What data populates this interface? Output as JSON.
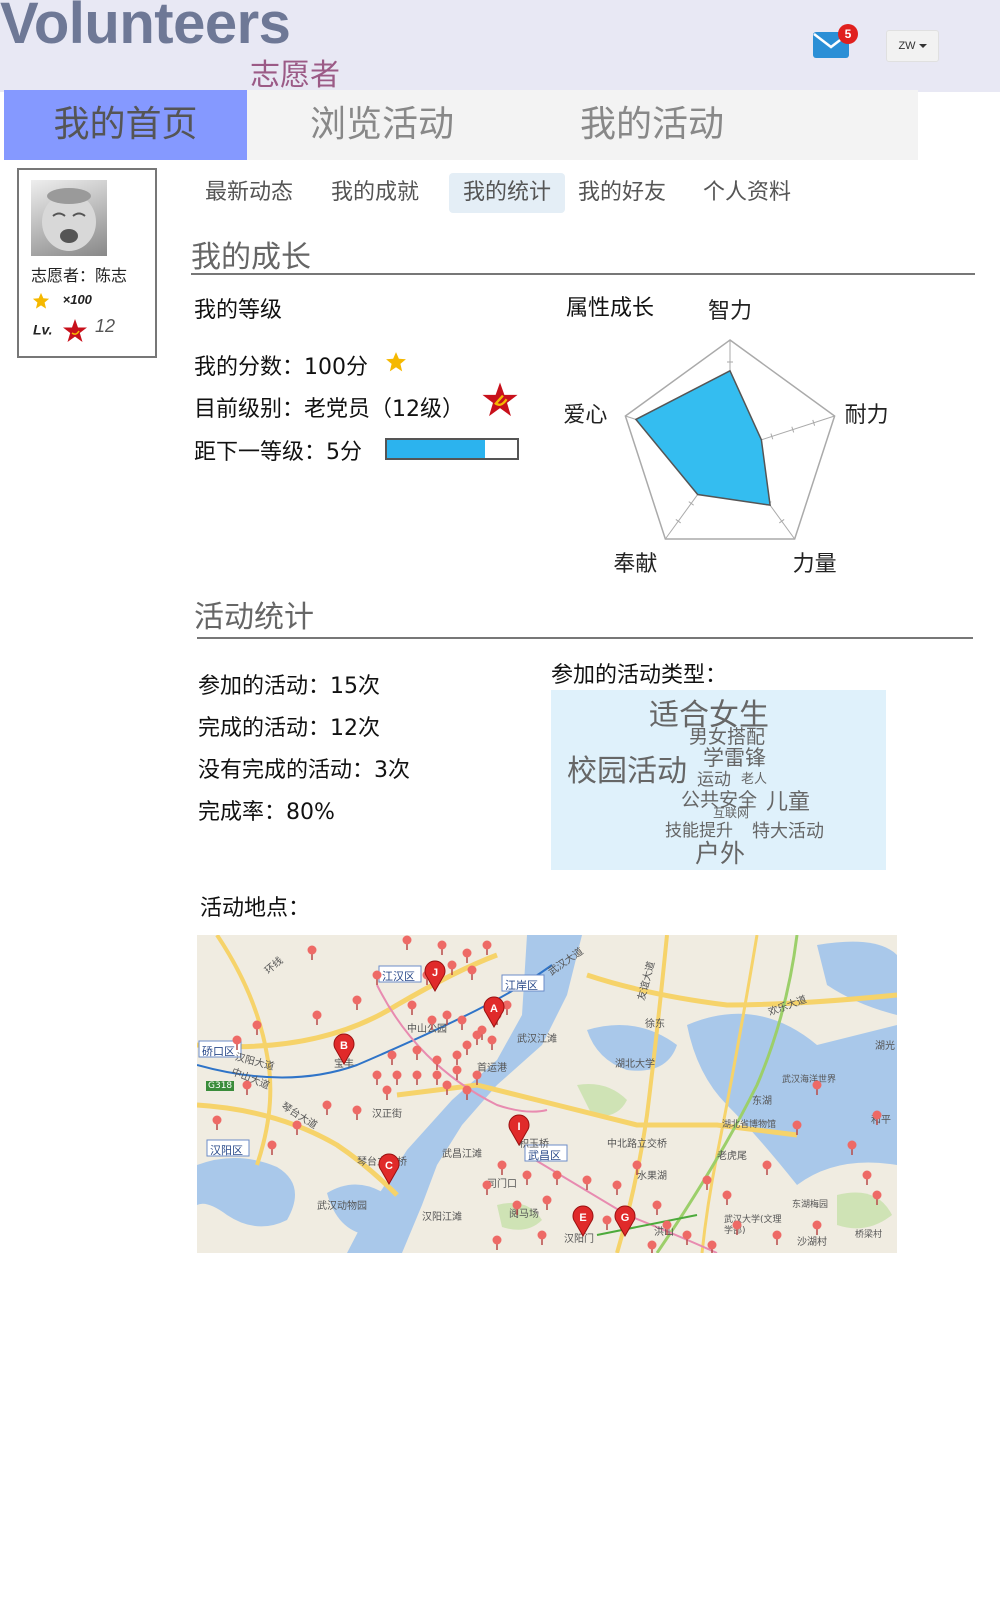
{
  "header": {
    "brand_en": "Volunteers",
    "brand_zh": "志愿者",
    "mail_badge": "5",
    "user_label": "ZW"
  },
  "main_nav": {
    "items": [
      {
        "label": "我的首页",
        "active": true
      },
      {
        "label": "浏览活动",
        "active": false
      },
      {
        "label": "我的活动",
        "active": false
      }
    ]
  },
  "profile": {
    "name": "志愿者：陈志",
    "star_count": "×100",
    "lv_label": "Lv.",
    "lv_value": "12"
  },
  "sub_nav": {
    "items": [
      {
        "label": "最新动态",
        "active": false
      },
      {
        "label": "我的成就",
        "active": false
      },
      {
        "label": "我的统计",
        "active": true
      },
      {
        "label": "我的好友",
        "active": false
      },
      {
        "label": "个人资料",
        "active": false
      }
    ]
  },
  "growth": {
    "title": "我的成长",
    "level_heading": "我的等级",
    "score": "我的分数：100分",
    "rank": "目前级别：老党员（12级）",
    "next": "距下一等级：5分",
    "progress": 0.75,
    "attr_heading": "属性成长",
    "radar": {
      "axes": [
        "智力",
        "耐力",
        "力量",
        "奉献",
        "爱心"
      ],
      "values": [
        0.72,
        0.3,
        0.62,
        0.5,
        0.9
      ]
    }
  },
  "activity": {
    "title": "活动统计",
    "joined": "参加的活动：15次",
    "completed": "完成的活动：12次",
    "not_completed": "没有完成的活动：3次",
    "rate": "完成率：80%",
    "types_heading": "参加的活动类型：",
    "tags": [
      "适合女生",
      "男女搭配",
      "学雷锋",
      "校园活动",
      "运动",
      "老人",
      "公共安全",
      "儿童",
      "互联网",
      "技能提升",
      "特大活动",
      "户外"
    ],
    "location_heading": "活动地点："
  },
  "map": {
    "districts": [
      "江汉区",
      "江岸区",
      "硚口区",
      "汉阳区",
      "武昌区"
    ],
    "places": [
      "中山公园",
      "汉正街",
      "琴台立交桥",
      "武汉动物园",
      "首运港",
      "武汉江滩",
      "汉阳江滩",
      "武昌江滩",
      "积玉桥",
      "中北路立交桥",
      "水果湖",
      "徐东",
      "湖北大学",
      "武汉海洋世界",
      "东湖",
      "湖北省博物馆",
      "老虎尾",
      "东湖梅园",
      "洪山",
      "武汉大学(文理学部)",
      "沙湖村",
      "桥梁村",
      "和平",
      "湖光",
      "阅马场",
      "司门口",
      "宝丰",
      "汉阳门",
      "中山大道"
    ],
    "roads": [
      "武汉大道",
      "欢乐大道",
      "汉阳大道",
      "琴台大道",
      "友谊大道",
      "环线",
      "G318"
    ],
    "markers": [
      "A",
      "B",
      "C",
      "E",
      "G",
      "I",
      "J"
    ]
  }
}
